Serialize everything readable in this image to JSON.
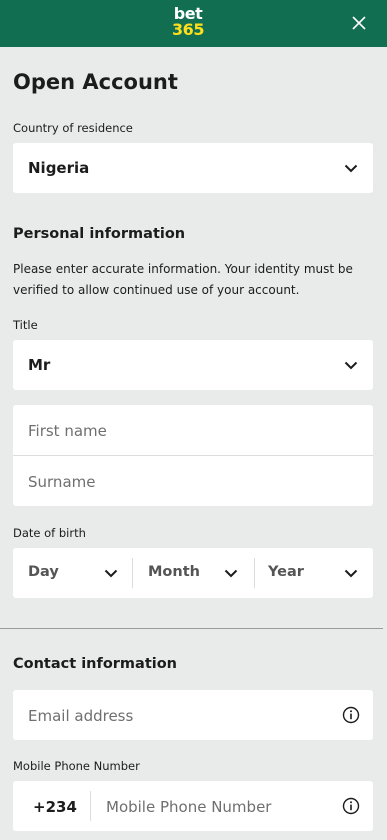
{
  "header": {
    "logo_line1": "bet",
    "logo_line2": "365",
    "close_icon": "close-icon",
    "brand_color": "#126e51",
    "logo_accent": "#ffdf1b"
  },
  "page": {
    "title": "Open Account"
  },
  "country": {
    "label": "Country of residence",
    "value": "Nigeria"
  },
  "personal": {
    "heading": "Personal information",
    "info_line1": "Please enter accurate information. Your identity must be",
    "info_line2": "verified to allow continued use of your account.",
    "title_label": "Title",
    "title_value": "Mr",
    "first_name_placeholder": "First name",
    "surname_placeholder": "Surname",
    "dob_label": "Date of birth",
    "dob_day": "Day",
    "dob_month": "Month",
    "dob_year": "Year"
  },
  "contact": {
    "heading": "Contact information",
    "email_placeholder": "Email address",
    "mobile_label": "Mobile Phone Number",
    "dial_code": "+234",
    "mobile_placeholder": "Mobile Phone Number",
    "info_icon": "info-icon"
  }
}
